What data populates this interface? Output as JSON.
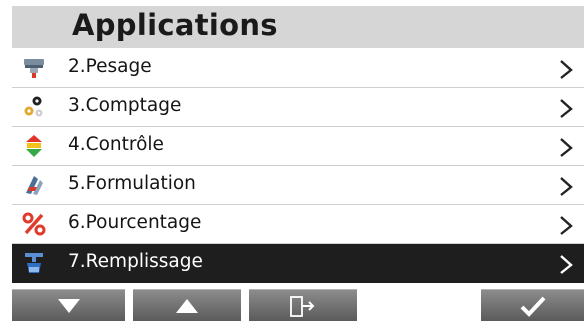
{
  "header": {
    "title": "Applications"
  },
  "menu": {
    "items": [
      {
        "label": "2.Pesage",
        "icon": "weighing-icon",
        "selected": false
      },
      {
        "label": "3.Comptage",
        "icon": "parts-counting-icon",
        "selected": false
      },
      {
        "label": "4.Contrôle",
        "icon": "check-weighing-icon",
        "selected": false
      },
      {
        "label": "5.Formulation",
        "icon": "formulation-icon",
        "selected": false
      },
      {
        "label": "6.Pourcentage",
        "icon": "percent-icon",
        "selected": true
      },
      {
        "label": "7.Remplissage",
        "icon": "filling-icon",
        "selected": true
      }
    ]
  },
  "footer": {
    "buttons": [
      {
        "name": "down",
        "icon": "arrow-down-icon"
      },
      {
        "name": "up",
        "icon": "arrow-up-icon"
      },
      {
        "name": "exit",
        "icon": "exit-icon"
      },
      {
        "name": "confirm",
        "icon": "checkmark-icon"
      }
    ]
  },
  "colors": {
    "title_bar": "#d6d6d6",
    "selected_row": "#1e1e1e",
    "button": "#6e6e6e",
    "percent_red": "#e03a2b"
  }
}
